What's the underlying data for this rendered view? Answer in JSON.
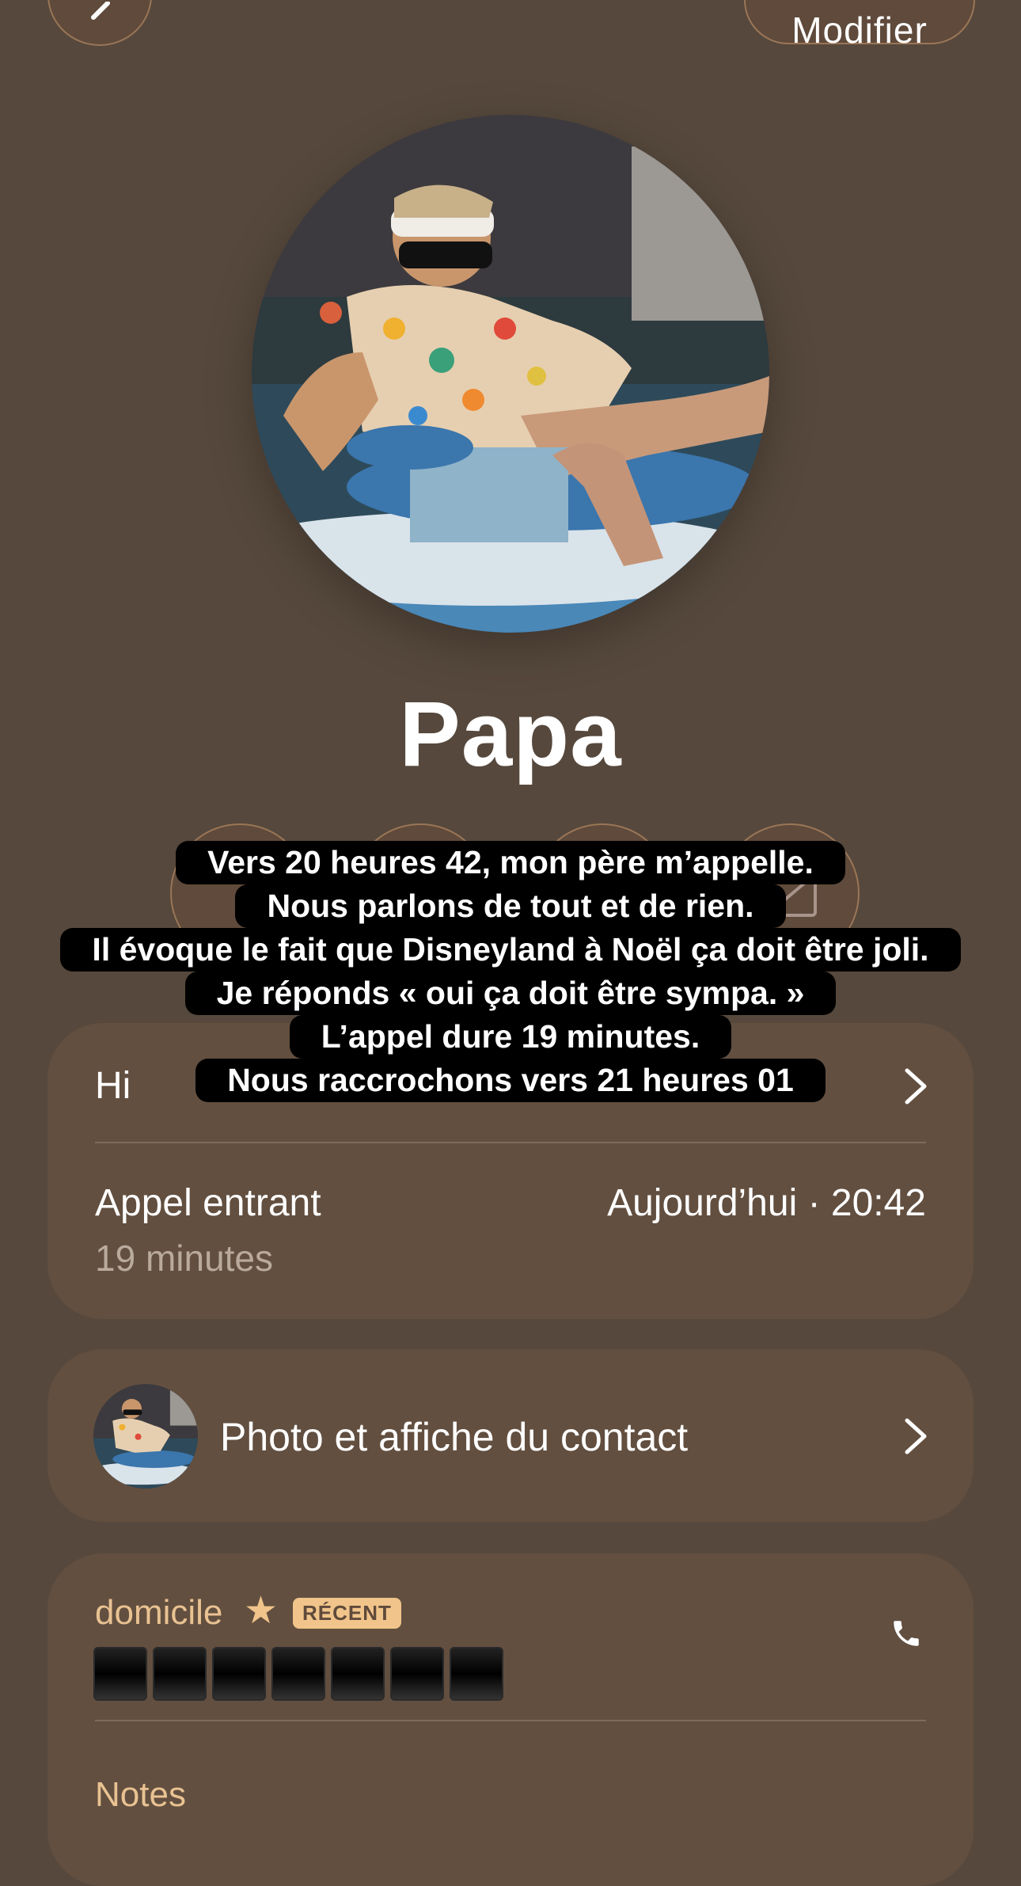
{
  "header": {
    "edit_label": "Modifier"
  },
  "contact": {
    "name": "Papa"
  },
  "caption": {
    "lines": [
      "Vers 20 heures 42, mon père m’appelle.",
      "Nous parlons de tout et de rien.",
      "Il évoque le fait que Disneyland à Noël ça doit être joli.",
      "Je réponds « oui ça doit être sympa. »",
      "L’appel dure 19 minutes.",
      "Nous raccrochons vers 21 heures 01"
    ]
  },
  "history": {
    "title": "Hi",
    "call_type": "Appel entrant",
    "call_time": "Aujourd’hui · 20:42",
    "duration": "19 minutes"
  },
  "photo_card": {
    "label": "Photo et affiche du contact"
  },
  "phone": {
    "label": "domicile",
    "badge": "RÉCENT",
    "notes_label": "Notes"
  },
  "icons": [
    "chevron-left-icon",
    "mail-icon",
    "chevron-right-icon",
    "star-icon",
    "phone-icon"
  ]
}
